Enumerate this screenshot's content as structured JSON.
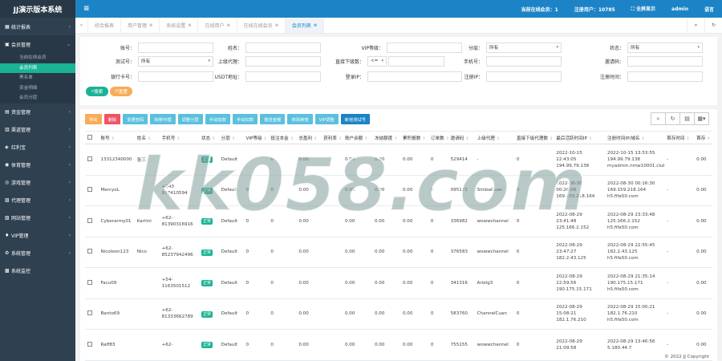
{
  "sidebar": {
    "brand": "JJ演示版本系统",
    "items": [
      {
        "label": "统计报表",
        "icon": "chart-icon"
      },
      {
        "label": "会员管理",
        "icon": "user-icon"
      },
      {
        "label": "资金管理",
        "icon": "money-icon"
      },
      {
        "label": "渠道管理",
        "icon": "channel-icon"
      },
      {
        "label": "红利宝",
        "icon": "gift-icon"
      },
      {
        "label": "体育管理",
        "icon": "sport-icon"
      },
      {
        "label": "游戏管理",
        "icon": "game-icon"
      },
      {
        "label": "代理管理",
        "icon": "agent-icon"
      },
      {
        "label": "网站管理",
        "icon": "site-icon"
      },
      {
        "label": "VIP管理",
        "icon": "vip-icon"
      },
      {
        "label": "系统管理",
        "icon": "gear-icon"
      },
      {
        "label": "系统监控",
        "icon": "monitor-icon"
      }
    ],
    "sub_items": [
      "当前在线会员",
      "会员列表",
      "黑名单",
      "资金明细",
      "会员分层"
    ]
  },
  "topbar": {
    "online": "当前在线会员：1",
    "registered": "注册用户：10785",
    "fullscreen": "全屏显示",
    "user": "admin",
    "language": "语言"
  },
  "tabs": [
    "综合报表",
    "用户管理",
    "系统设置",
    "在线用户",
    "在线在线会员",
    "会员列表"
  ],
  "filters": {
    "row1": [
      {
        "label": "账号：",
        "value": ""
      },
      {
        "label": "姓名：",
        "value": ""
      },
      {
        "label": "VIP等级：",
        "value": ""
      },
      {
        "label": "分层：",
        "value": "所有",
        "select": true
      },
      {
        "label": "状态：",
        "value": "所有",
        "select": true
      }
    ],
    "row2": [
      {
        "label": "测试号：",
        "value": "所有",
        "select": true
      },
      {
        "label": "上级代理：",
        "value": ""
      },
      {
        "label": "直接下级数：",
        "value": "<=",
        "select": true
      },
      {
        "label": "手机号：",
        "value": ""
      },
      {
        "label": "邀请码：",
        "value": ""
      }
    ],
    "row3": [
      {
        "label": "银行卡号：",
        "value": ""
      },
      {
        "label": "USDT地址：",
        "value": ""
      },
      {
        "label": "登录IP：",
        "value": ""
      },
      {
        "label": "注册IP：",
        "value": ""
      },
      {
        "label": "注册时间：",
        "value": ""
      }
    ],
    "search_button": "搜索",
    "reset_button": "重置"
  },
  "toolbar": {
    "buttons": [
      {
        "label": "导出",
        "color": "#f8ac59"
      },
      {
        "label": "删除",
        "color": "#ed5565"
      },
      {
        "label": "变更密码",
        "color": "#5bc0de"
      },
      {
        "label": "转移代理",
        "color": "#5bc0de"
      },
      {
        "label": "调整分层",
        "color": "#5bc0de"
      },
      {
        "label": "手动加款",
        "color": "#5bc0de"
      },
      {
        "label": "手动扣款",
        "color": "#5bc0de"
      },
      {
        "label": "赠送金额",
        "color": "#5bc0de"
      },
      {
        "label": "修改荣誉",
        "color": "#5bc0de"
      },
      {
        "label": "VIP调整",
        "color": "#5bc0de"
      },
      {
        "label": "新增测试号",
        "color": "#1c84c6"
      }
    ]
  },
  "table": {
    "headers": [
      "账号",
      "姓名",
      "手机号",
      "状态",
      "分层",
      "VIP等级",
      "投注本金",
      "总盈利",
      "获利率",
      "账户余额",
      "冻结额度",
      "累积报数",
      "订单数",
      "邀请码",
      "上级代理",
      "直接下级代理数",
      "最后活跃时间IP",
      "注册时间IP/域名",
      "首存时间",
      "首存"
    ],
    "rows": [
      {
        "account": "13312340000",
        "name": "张三",
        "phone": "",
        "status": "正常",
        "tier": "Default",
        "vip": "",
        "bet": "0",
        "profit": "0.00",
        "rate": "",
        "balance": "0.00",
        "frozen": "0.00",
        "accum": "0.00",
        "orders": "0",
        "invite": "529414",
        "agent": "-",
        "sub": "0",
        "last": [
          "2022-10-15",
          "22:43:05",
          "194.99.79.138"
        ],
        "reg": [
          "2022-10-15 13:53:55",
          "194.99.79.138",
          "myadmin.nmw10001.club"
        ],
        "first_time": "-",
        "first": "0.00"
      },
      {
        "account": "MercyoL",
        "name": "",
        "phone": "+243 977410594",
        "status": "正常",
        "tier": "Default",
        "vip": "0",
        "bet": "0",
        "profit": "0.00",
        "rate": "",
        "balance": "0.00",
        "frozen": "0.00",
        "accum": "0.00",
        "orders": "0",
        "invite": "095172",
        "agent": "SimbaCuan",
        "sub": "0",
        "last": [
          "2022-08-30",
          "00:26:06",
          "169.159.218.164"
        ],
        "reg": [
          "2022-08-30 00:16:30",
          "169.159.218.164",
          "h5.fifa50.com"
        ],
        "first_time": "-",
        "first": "0.00"
      },
      {
        "account": "Cyberarmy01",
        "name": "Kartini",
        "phone": "+62-81390316916",
        "status": "正常",
        "tier": "Default",
        "vip": "0",
        "bet": "0",
        "profit": "0.00",
        "rate": "",
        "balance": "0.00",
        "frozen": "0.00",
        "accum": "0.00",
        "orders": "0",
        "invite": "336982",
        "agent": "wowwchannel",
        "sub": "0",
        "last": [
          "2022-08-29",
          "23:41:48",
          "125.166.2.152"
        ],
        "reg": [
          "2022-08-29 23:33:48",
          "125.166.2.152",
          "h5.fifa50.com"
        ],
        "first_time": "-",
        "first": "0.00"
      },
      {
        "account": "Nicoleon123",
        "name": "Nico",
        "phone": "+62-85237942496",
        "status": "正常",
        "tier": "Default",
        "vip": "0",
        "bet": "0",
        "profit": "0.00",
        "rate": "",
        "balance": "0.00",
        "frozen": "0.00",
        "accum": "0.00",
        "orders": "0",
        "invite": "376583",
        "agent": "wowwchannel",
        "sub": "0",
        "last": [
          "2022-08-29",
          "23:47:27",
          "182.2.43.125"
        ],
        "reg": [
          "2022-08-29 22:55:45",
          "182.2.43.125",
          "h5.fifa50.com"
        ],
        "first_time": "-",
        "first": "0.00"
      },
      {
        "account": "Facu09",
        "name": "",
        "phone": "+54-1163501512",
        "status": "正常",
        "tier": "Default",
        "vip": "0",
        "bet": "0",
        "profit": "0.00",
        "rate": "",
        "balance": "0.00",
        "frozen": "0.00",
        "accum": "0.00",
        "orders": "0",
        "invite": "341316",
        "agent": "Arielg3",
        "sub": "0",
        "last": [
          "2022-08-29",
          "22:59:56",
          "190.175.15.171"
        ],
        "reg": [
          "2022-08-29 21:35:14",
          "190.175.15.171",
          "h5.fifa50.com"
        ],
        "first_time": "-",
        "first": "0.00"
      },
      {
        "account": "Banto69",
        "name": "",
        "phone": "+62-81333662789",
        "status": "正常",
        "tier": "Default",
        "vip": "0",
        "bet": "0",
        "profit": "0.00",
        "rate": "",
        "balance": "0.00",
        "frozen": "0.00",
        "accum": "0.00",
        "orders": "0",
        "invite": "583760",
        "agent": "ChannelCuan",
        "sub": "0",
        "last": [
          "2022-08-29",
          "15:08:21",
          "182.1.76.210"
        ],
        "reg": [
          "2022-08-29 15:00:21",
          "182.1.76.210",
          "h5.fifa50.com"
        ],
        "first_time": "-",
        "first": "0.00"
      },
      {
        "account": "Raff83",
        "name": "",
        "phone": "+62-",
        "status": "正常",
        "tier": "Default",
        "vip": "0",
        "bet": "0",
        "profit": "0.00",
        "rate": "",
        "balance": "0.00",
        "frozen": "0.00",
        "accum": "0.00",
        "orders": "0",
        "invite": "755155",
        "agent": "wowwchannel",
        "sub": "0",
        "last": [
          "2022-08-29",
          "21:09:58"
        ],
        "reg": [
          "2022-08-29 13:46:56",
          "5.180.44.7"
        ],
        "first_time": "-",
        "first": "0.00"
      }
    ]
  },
  "footer": "© 2022 JJ Copyright",
  "watermark": "kk058.com"
}
